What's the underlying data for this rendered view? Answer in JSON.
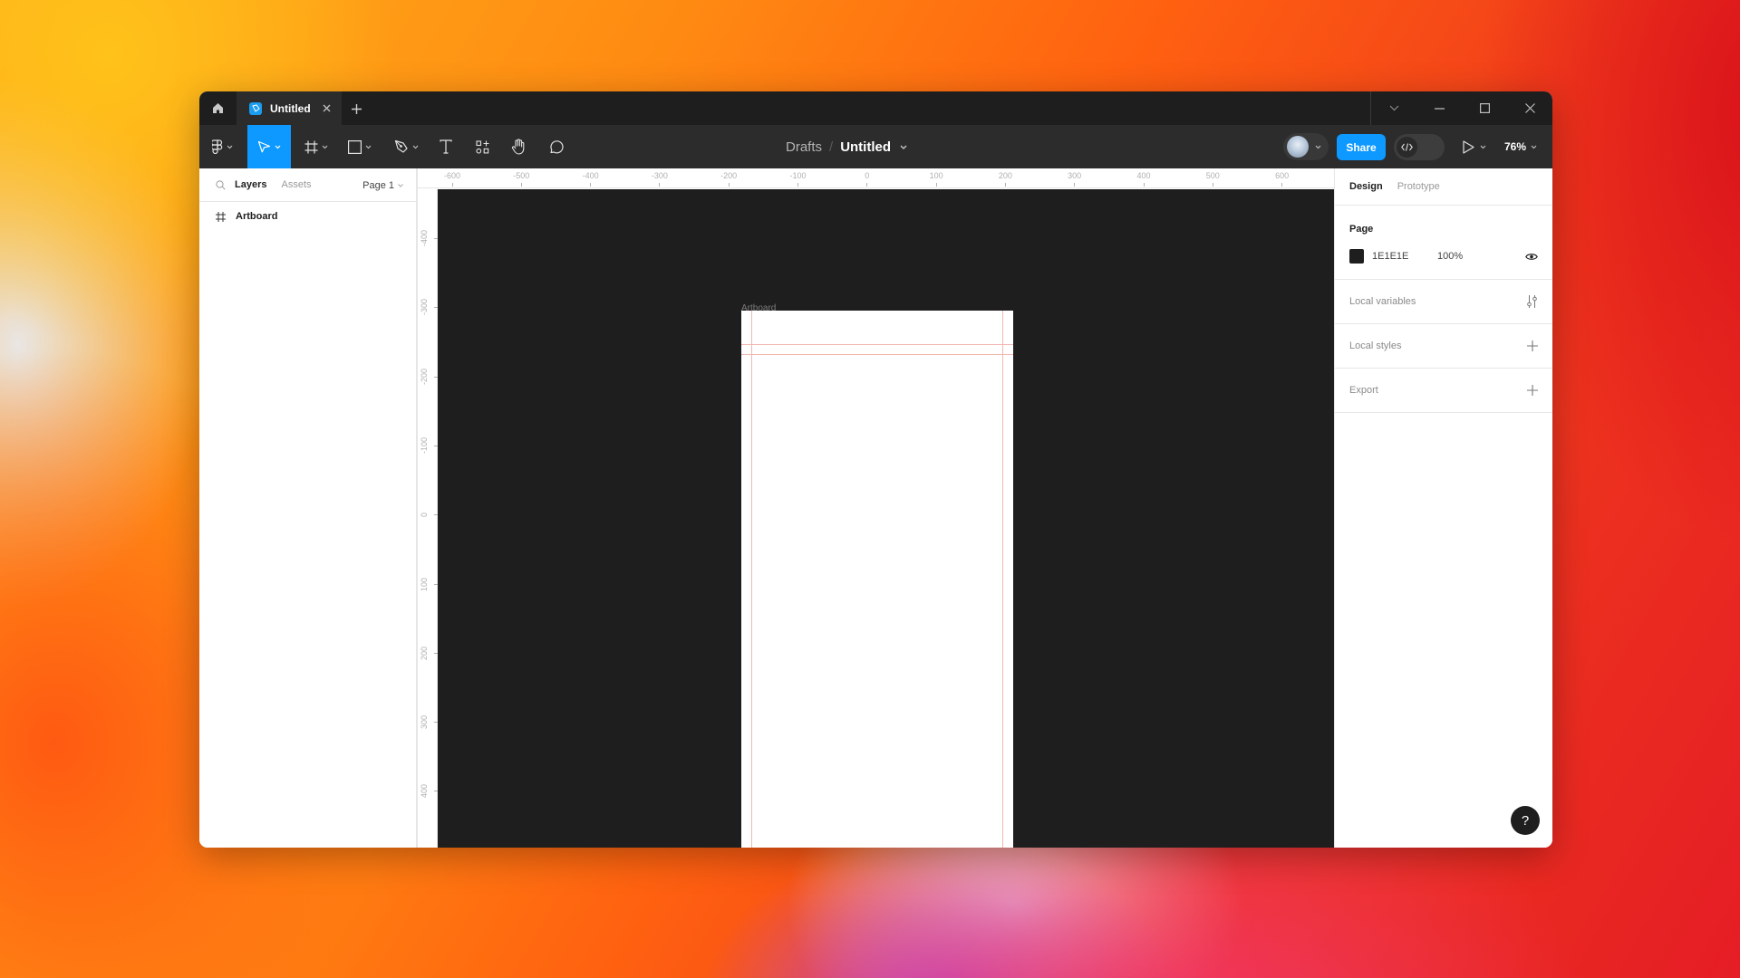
{
  "titlebar": {
    "tab_title": "Untitled",
    "icons": {
      "home": "home-icon",
      "file": "figma-file-icon",
      "close": "close-icon",
      "new_tab": "plus-icon",
      "tabs_menu": "chevron-down-icon",
      "minimize": "minimize-icon",
      "maximize": "maximize-icon",
      "window_close": "close-icon"
    }
  },
  "toolbar": {
    "tools": [
      {
        "name": "main-menu",
        "icon": "figma-logo-icon",
        "active": false
      },
      {
        "name": "move",
        "icon": "cursor-arrow-icon",
        "active": true
      },
      {
        "name": "frame",
        "icon": "frame-hash-icon",
        "active": false
      },
      {
        "name": "shape",
        "icon": "rectangle-icon",
        "active": false
      },
      {
        "name": "pen",
        "icon": "pen-icon",
        "active": false
      },
      {
        "name": "text",
        "icon": "text-icon",
        "active": false
      },
      {
        "name": "resources",
        "icon": "components-icon",
        "active": false
      },
      {
        "name": "hand",
        "icon": "hand-icon",
        "active": false
      },
      {
        "name": "comment",
        "icon": "comment-icon",
        "active": false
      }
    ],
    "breadcrumb": {
      "folder": "Drafts",
      "separator": "/",
      "file": "Untitled"
    },
    "share_label": "Share",
    "dev_mode_icon": "code-icon",
    "present_icon": "play-icon",
    "zoom_level": "76%"
  },
  "left_panel": {
    "tabs": {
      "layers": "Layers",
      "assets": "Assets"
    },
    "page_selector": "Page 1",
    "layers": [
      {
        "name": "Artboard",
        "icon": "frame-hash-icon"
      }
    ]
  },
  "rulers": {
    "horizontal": [
      "-600",
      "-500",
      "-400",
      "-300",
      "-200",
      "-100",
      "0",
      "100",
      "200",
      "300",
      "400",
      "500",
      "600"
    ],
    "vertical": [
      "-400",
      "-300",
      "-200",
      "-100",
      "0",
      "100",
      "200",
      "300",
      "400"
    ]
  },
  "canvas": {
    "background": "#1E1E1E",
    "artboard_label": "Artboard",
    "guide_color": "#F0B8B0"
  },
  "right_panel": {
    "tabs": {
      "design": "Design",
      "prototype": "Prototype"
    },
    "page": {
      "title": "Page",
      "color_hex": "1E1E1E",
      "opacity": "100%"
    },
    "sections": [
      {
        "label": "Local variables",
        "icon": "variables-icon"
      },
      {
        "label": "Local styles",
        "icon": "plus-icon"
      },
      {
        "label": "Export",
        "icon": "plus-icon"
      }
    ],
    "help_label": "?"
  },
  "colors": {
    "accent": "#0D99FF",
    "chrome_dark": "#1E1E1E",
    "toolbar": "#2C2C2C"
  }
}
